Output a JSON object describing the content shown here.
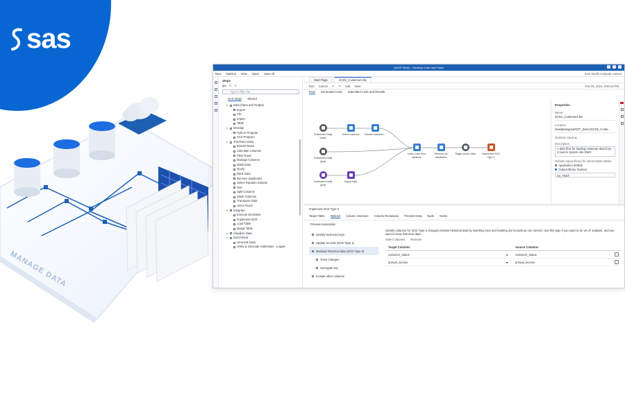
{
  "brand": {
    "logo_text": "sas",
    "color": "#0766d1"
  },
  "illustration": {
    "label": "MANAGE DATA"
  },
  "app": {
    "title": "SAS® Studio - Develop Code and Flows",
    "menu": [
      "New",
      "Options",
      "View",
      "Open",
      "Save All"
    ],
    "menu_right": "SAS Studio compute context",
    "steps_panel": {
      "title": "Steps",
      "filter_placeholder": "Type to filter list",
      "tabs": [
        "SAS Steps",
        "Shared"
      ],
      "tree": [
        {
          "t": "cat",
          "label": "Data (Input and Output)"
        },
        {
          "t": "item",
          "label": "Export"
        },
        {
          "t": "item",
          "label": "File"
        },
        {
          "t": "item",
          "label": "Import"
        },
        {
          "t": "item",
          "label": "Table"
        },
        {
          "t": "cat",
          "label": "Develop"
        },
        {
          "t": "item",
          "label": "Python Program"
        },
        {
          "t": "item",
          "label": "SAS Program"
        },
        {
          "t": "cat",
          "label": "Transform Data"
        },
        {
          "t": "item",
          "label": "Branch Rows"
        },
        {
          "t": "item",
          "label": "Calculate Columns"
        },
        {
          "t": "item",
          "label": "Filter Rows"
        },
        {
          "t": "item",
          "label": "Manage Columns"
        },
        {
          "t": "item",
          "label": "Mask Data"
        },
        {
          "t": "item",
          "label": "Query"
        },
        {
          "t": "item",
          "label": "Rank Data"
        },
        {
          "t": "item",
          "label": "Remove Duplicates"
        },
        {
          "t": "item",
          "label": "Select Random Sample"
        },
        {
          "t": "item",
          "label": "Sort"
        },
        {
          "t": "item",
          "label": "Split Columns"
        },
        {
          "t": "item",
          "label": "Stack Columns"
        },
        {
          "t": "item",
          "label": "Transpose Data"
        },
        {
          "t": "item",
          "label": "Union Rows"
        },
        {
          "t": "cat",
          "label": "Integrate"
        },
        {
          "t": "item",
          "label": "Execute Decisions"
        },
        {
          "t": "item",
          "label": "Implement SCD"
        },
        {
          "t": "item",
          "label": "Load Table"
        },
        {
          "t": "item",
          "label": "Merge Table"
        },
        {
          "t": "cat",
          "label": "Visualize Data"
        },
        {
          "t": "cat",
          "label": "Enrichment"
        },
        {
          "t": "item",
          "label": "Geocode Data"
        },
        {
          "t": "item",
          "label": "Verify & Geocode Addresses - Loqate"
        }
      ]
    },
    "doc_tabs": [
      "Start Page",
      "SCD2_Customers.flw"
    ],
    "toolbar": [
      "Run",
      "Cancel",
      "Add",
      "View"
    ],
    "toolbar_right": "Feb 09, 2024, 8:59:18 PM",
    "sub_tabs": [
      "Flow",
      "Generated Code",
      "Submitted Code and Results"
    ],
    "flow": {
      "nodes": [
        {
          "id": "n1",
          "label": "Customers Daily (cust)",
          "color": "#555d66"
        },
        {
          "id": "n2",
          "label": "Customers Daily (bcd)",
          "color": "#555d66"
        },
        {
          "id": "n3",
          "label": "Customers Daily (dcd)",
          "color": "#6a3fb5"
        },
        {
          "id": "n4",
          "label": "Select columns",
          "color": "#3a7fd0"
        },
        {
          "id": "n5",
          "label": "Extract customer...",
          "color": "#3a7fd0"
        },
        {
          "id": "n6",
          "label": "Import data",
          "color": "#6a3fb5"
        },
        {
          "id": "n7",
          "label": "Union rows from systems",
          "color": "#3a7fd0"
        },
        {
          "id": "n8",
          "label": "Remove full duplicates",
          "color": "#3a7fd0"
        },
        {
          "id": "n9",
          "label": "Stage source data",
          "color": "#555d66"
        },
        {
          "id": "n10",
          "label": "Implement SCD Type 2",
          "color": "#c5582a"
        }
      ]
    },
    "properties": {
      "title": "Properties",
      "name_label": "Name:",
      "name_value": "SCD2_Customers.flw",
      "location_label": "Location:",
      "location_value": "/sasdata/sgraw/EZT_Demo/SCD2_Custo...",
      "opt_label": "Optimize steps",
      "desc_label": "Description:",
      "desc_value": "A data flow for loading customer data from 3 source system into DWH",
      "lib_label": "Default output library for intermediate tables:",
      "opt1": "Application default",
      "opt2": "Output library location",
      "lib_value": "S2_TEST"
    },
    "bottom": {
      "header": "Implement SCD Type 2",
      "tabs": [
        "Target Table",
        "Options",
        "Column Structure",
        "Column Resolution",
        "Preview Data",
        "Node",
        "Notes"
      ],
      "preview": "Preview expression",
      "left_items": [
        {
          "label": "Identify business keys",
          "sel": false,
          "sub": false
        },
        {
          "label": "Update records (SCD Type 1)",
          "sel": false,
          "sub": false
        },
        {
          "label": "Maintain historical data (SCD Type 2)",
          "sel": true,
          "sub": false
        },
        {
          "label": "Track changes",
          "sel": false,
          "sub": true
        },
        {
          "label": "Surrogate key",
          "sel": false,
          "sub": true
        },
        {
          "label": "Include other columns",
          "sel": false,
          "sub": false
        }
      ],
      "description": "Identify columns for SCD Type 2 changes (retains historical data by inserting rows and marking old records as not current). Use this type if you want to do 'as of' analysis, and you want to keep historical data.",
      "select_columns": "Select columns",
      "remove": "Remove",
      "col_target": "Target Columns",
      "col_source": "Source Columns",
      "rows": [
        {
          "target": "customer_status",
          "source": "customer_status"
        },
        {
          "target": "annual_income",
          "source": "annual_income"
        }
      ]
    }
  }
}
